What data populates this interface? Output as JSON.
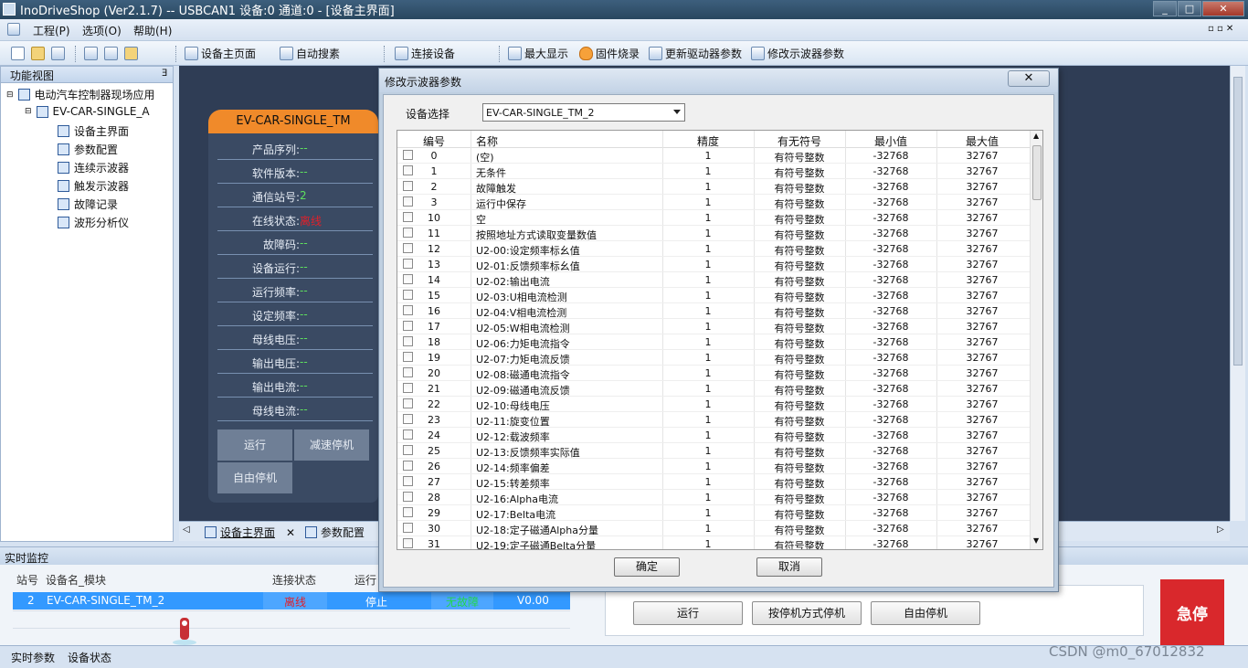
{
  "window": {
    "title": "InoDriveShop (Ver2.1.7) -- USBCAN1 设备:0 通道:0 - [设备主界面]",
    "controls": [
      "_",
      "□",
      "✕"
    ]
  },
  "menu": {
    "items": [
      "工程(P)",
      "选项(O)",
      "帮助(H)"
    ]
  },
  "toolbar": {
    "home": "设备主页面",
    "search": "自动搜素",
    "connect": "连接设备",
    "maximize": "最大显示",
    "firmware": "固件烧录",
    "update_driver": "更新驱动器参数",
    "scope_params": "修改示波器参数"
  },
  "left_panel": {
    "header": "功能视图",
    "root": "电动汽车控制器现场应用",
    "device": "EV-CAR-SINGLE_A",
    "items": [
      "设备主界面",
      "参数配置",
      "连续示波器",
      "触发示波器",
      "故障记录",
      "波形分析仪"
    ]
  },
  "device_card": {
    "title": "EV-CAR-SINGLE_TM",
    "props": [
      {
        "label": "产品序列:",
        "value": "--"
      },
      {
        "label": "软件版本:",
        "value": "--"
      },
      {
        "label": "通信站号:",
        "value": "2"
      },
      {
        "label": "在线状态:",
        "value": "离线"
      },
      {
        "label": "故障码:",
        "value": "--"
      },
      {
        "label": "设备运行:",
        "value": "--"
      },
      {
        "label": "运行频率:",
        "value": "--"
      },
      {
        "label": "设定频率:",
        "value": "--"
      },
      {
        "label": "母线电压:",
        "value": "--"
      },
      {
        "label": "输出电压:",
        "value": "--"
      },
      {
        "label": "输出电流:",
        "value": "--"
      },
      {
        "label": "母线电流:",
        "value": "--"
      }
    ],
    "buttons": {
      "run": "运行",
      "decel_stop": "减速停机",
      "free_stop": "自由停机"
    }
  },
  "tabs": {
    "main": "设备主界面",
    "params": "参数配置"
  },
  "monitor": {
    "header": "实时监控",
    "columns": [
      "站号",
      "设备名_模块",
      "连接状态",
      "运行"
    ],
    "row": {
      "station": "2",
      "name": "EV-CAR-SINGLE_TM_2",
      "conn": "离线",
      "run": "停止",
      "fault": "无故障",
      "version": "V0.00"
    },
    "controls": {
      "run": "运行",
      "stop_mode": "按停机方式停机",
      "free_stop": "自由停机",
      "estop": "急停"
    }
  },
  "bottom_tabs": [
    "实时参数",
    "设备状态"
  ],
  "watermark": "CSDN @m0_67012832",
  "colors": {
    "accent_orange": "#f08a2a",
    "status_red": "#e0202a",
    "selection_blue": "#3399ff",
    "value_green": "#5ee05e"
  },
  "dialog": {
    "title": "修改示波器参数",
    "close": "✕",
    "device_select_label": "设备选择",
    "device_selected": "EV-CAR-SINGLE_TM_2",
    "headers": [
      "编号",
      "名称",
      "精度",
      "有无符号",
      "最小值",
      "最大值"
    ],
    "rows": [
      [
        "0",
        "(空)",
        "1",
        "有符号整数",
        "-32768",
        "32767"
      ],
      [
        "1",
        "无条件",
        "1",
        "有符号整数",
        "-32768",
        "32767"
      ],
      [
        "2",
        "故障触发",
        "1",
        "有符号整数",
        "-32768",
        "32767"
      ],
      [
        "3",
        "运行中保存",
        "1",
        "有符号整数",
        "-32768",
        "32767"
      ],
      [
        "10",
        "空",
        "1",
        "有符号整数",
        "-32768",
        "32767"
      ],
      [
        "11",
        "按照地址方式读取变量数值",
        "1",
        "有符号整数",
        "-32768",
        "32767"
      ],
      [
        "12",
        "U2-00:设定频率标幺值",
        "1",
        "有符号整数",
        "-32768",
        "32767"
      ],
      [
        "13",
        "U2-01:反馈频率标幺值",
        "1",
        "有符号整数",
        "-32768",
        "32767"
      ],
      [
        "14",
        "U2-02:输出电流",
        "1",
        "有符号整数",
        "-32768",
        "32767"
      ],
      [
        "15",
        "U2-03:U相电流检测",
        "1",
        "有符号整数",
        "-32768",
        "32767"
      ],
      [
        "16",
        "U2-04:V相电流检测",
        "1",
        "有符号整数",
        "-32768",
        "32767"
      ],
      [
        "17",
        "U2-05:W相电流检测",
        "1",
        "有符号整数",
        "-32768",
        "32767"
      ],
      [
        "18",
        "U2-06:力矩电流指令",
        "1",
        "有符号整数",
        "-32768",
        "32767"
      ],
      [
        "19",
        "U2-07:力矩电流反馈",
        "1",
        "有符号整数",
        "-32768",
        "32767"
      ],
      [
        "20",
        "U2-08:磁通电流指令",
        "1",
        "有符号整数",
        "-32768",
        "32767"
      ],
      [
        "21",
        "U2-09:磁通电流反馈",
        "1",
        "有符号整数",
        "-32768",
        "32767"
      ],
      [
        "22",
        "U2-10:母线电压",
        "1",
        "有符号整数",
        "-32768",
        "32767"
      ],
      [
        "23",
        "U2-11:旋变位置",
        "1",
        "有符号整数",
        "-32768",
        "32767"
      ],
      [
        "24",
        "U2-12:载波频率",
        "1",
        "有符号整数",
        "-32768",
        "32767"
      ],
      [
        "25",
        "U2-13:反馈频率实际值",
        "1",
        "有符号整数",
        "-32768",
        "32767"
      ],
      [
        "26",
        "U2-14:频率偏差",
        "1",
        "有符号整数",
        "-32768",
        "32767"
      ],
      [
        "27",
        "U2-15:转差频率",
        "1",
        "有符号整数",
        "-32768",
        "32767"
      ],
      [
        "28",
        "U2-16:Alpha电流",
        "1",
        "有符号整数",
        "-32768",
        "32767"
      ],
      [
        "29",
        "U2-17:Belta电流",
        "1",
        "有符号整数",
        "-32768",
        "32767"
      ],
      [
        "30",
        "U2-18:定子磁通Alpha分量",
        "1",
        "有符号整数",
        "-32768",
        "32767"
      ],
      [
        "31",
        "U2-19:定子磁通Belta分量",
        "1",
        "有符号整数",
        "-32768",
        "32767"
      ]
    ],
    "ok": "确定",
    "cancel": "取消"
  }
}
